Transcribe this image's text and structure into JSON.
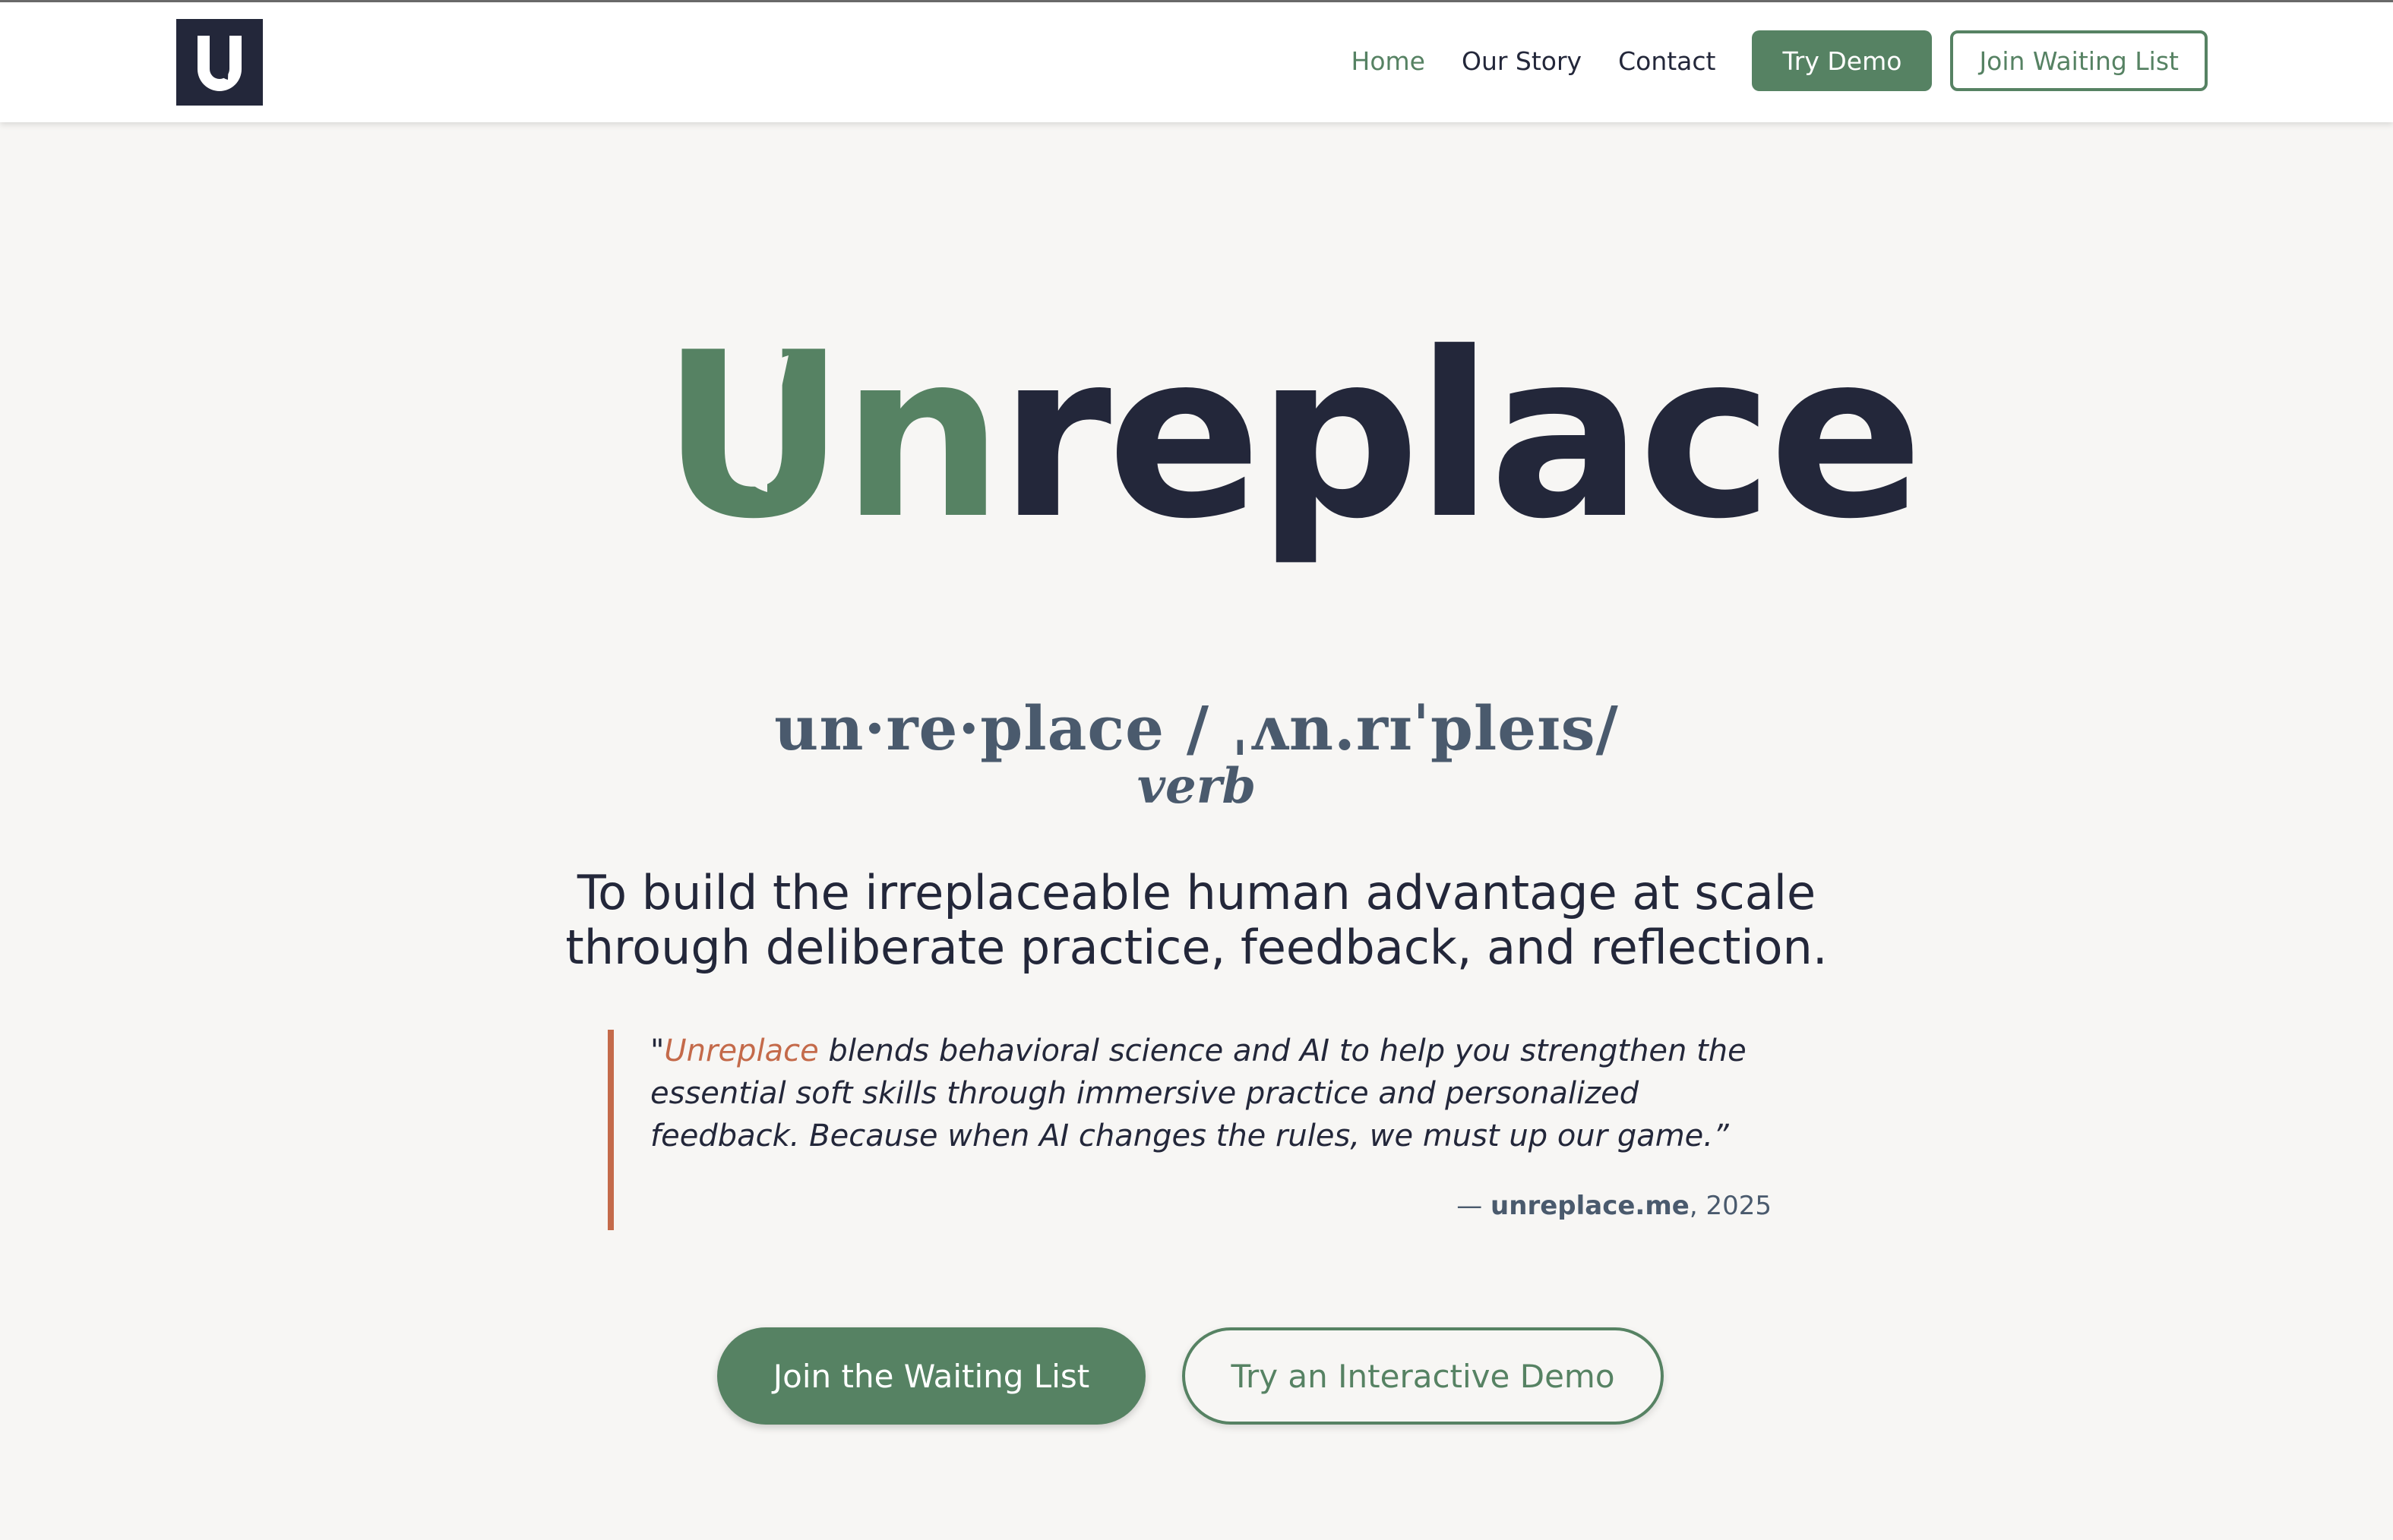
{
  "brand": {
    "name": "Unreplace",
    "logo_letter": "U"
  },
  "nav": {
    "items": [
      {
        "label": "Home",
        "active": true
      },
      {
        "label": "Our Story",
        "active": false
      },
      {
        "label": "Contact",
        "active": false
      }
    ],
    "try_demo": "Try Demo",
    "join_waiting_list": "Join Waiting List"
  },
  "hero": {
    "wordmark_green": "Un",
    "wordmark_dark": "replace"
  },
  "definition": {
    "word": "un·re·place / ˌʌn.rɪˈpleɪs/",
    "part_of_speech": "verb"
  },
  "mission": {
    "line1": "To build the irreplaceable human advantage at scale",
    "line2": "through deliberate practice, feedback, and reflection."
  },
  "quote": {
    "open": "\"",
    "highlight": "Unreplace",
    "body": " blends behavioral science and AI to help you strengthen the essential soft skills through immersive practice and personalized feedback. Because when AI changes the rules, we must up our game.”",
    "attribution_dash": "— ",
    "attribution_source": "unreplace.me",
    "attribution_year": ", 2025"
  },
  "cta": {
    "primary": "Join the Waiting List",
    "secondary": "Try an Interactive Demo"
  },
  "colors": {
    "green": "#568263",
    "navy": "#23273a",
    "slate": "#4a5a6d",
    "accent": "#c46a4a",
    "background": "#f7f6f4"
  }
}
